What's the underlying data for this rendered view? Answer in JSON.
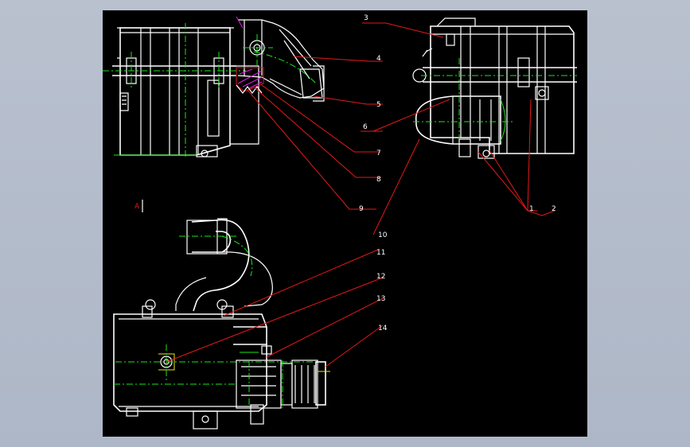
{
  "callouts": [
    "1",
    "2",
    "3",
    "4",
    "5",
    "6",
    "7",
    "8",
    "9",
    "10",
    "11",
    "12",
    "13",
    "14"
  ],
  "view_label": "A",
  "colors": {
    "background": "#000000",
    "outline": "#ffffff",
    "centerline": "#19e619",
    "leader": "#e51919",
    "hidden": "#e6e619",
    "accent": "#e619e6"
  }
}
